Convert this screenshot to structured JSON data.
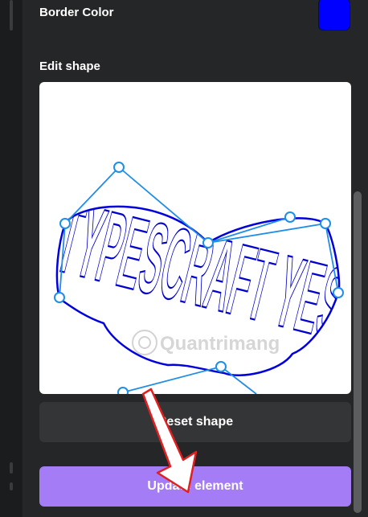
{
  "border_color": {
    "label": "Border Color",
    "value": "#0000ff"
  },
  "edit_shape": {
    "label": "Edit shape",
    "shape_text": "TYPESCRAFT YES",
    "stroke_color": "#1f8ee6",
    "text_color": "#0000cc"
  },
  "watermark": {
    "text": "Quantrimang"
  },
  "buttons": {
    "reset_label": "Reset shape",
    "update_label": "Update element",
    "update_color": "#a47cf5"
  },
  "annotation": {
    "arrow_color": "#e02020"
  }
}
